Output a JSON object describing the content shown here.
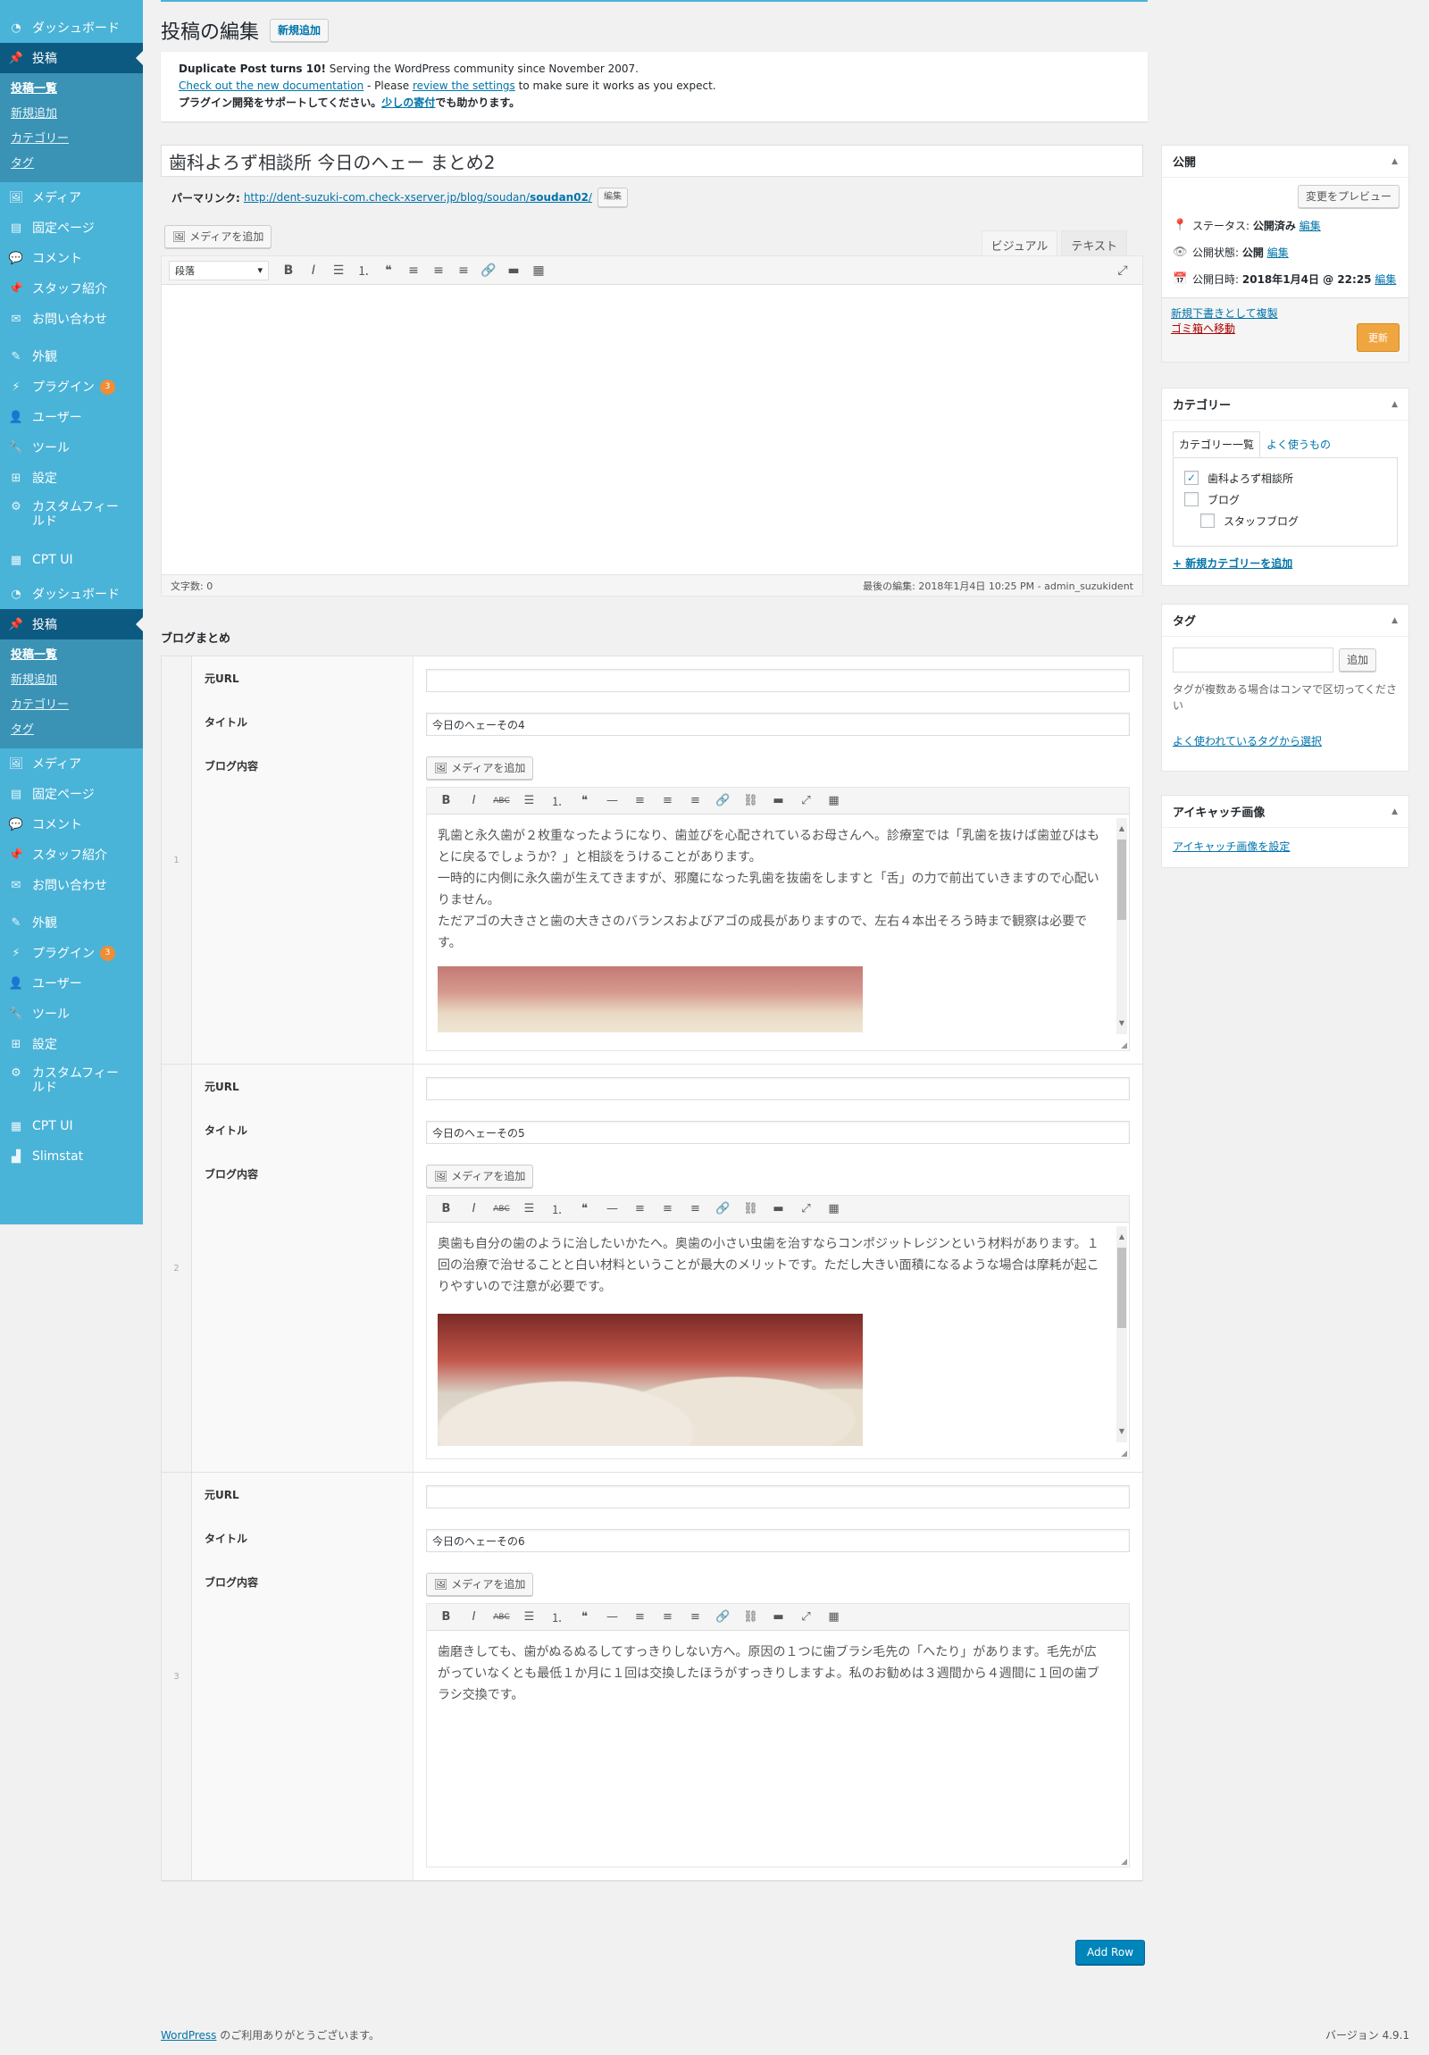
{
  "sidebar": {
    "menu1": [
      {
        "label": "ダッシュボード",
        "icon": "dashboard-icon"
      },
      {
        "label": "投稿",
        "icon": "pin-icon"
      },
      {
        "label": "メディア",
        "icon": "media-icon"
      },
      {
        "label": "固定ページ",
        "icon": "page-icon"
      },
      {
        "label": "コメント",
        "icon": "comment-icon"
      },
      {
        "label": "スタッフ紹介",
        "icon": "pin-icon"
      },
      {
        "label": "お問い合わせ",
        "icon": "mail-icon"
      },
      {
        "label": "外観",
        "icon": "brush-icon"
      },
      {
        "label": "プラグイン",
        "icon": "plugin-icon",
        "badge": "3"
      },
      {
        "label": "ユーザー",
        "icon": "user-icon"
      },
      {
        "label": "ツール",
        "icon": "wrench-icon"
      },
      {
        "label": "設定",
        "icon": "settings-icon"
      },
      {
        "label": "カスタムフィールド",
        "icon": "gear-icon"
      },
      {
        "label": "CPT UI",
        "icon": "cpt-icon"
      }
    ],
    "menu2": [
      {
        "label": "ダッシュボード",
        "icon": "dashboard-icon"
      },
      {
        "label": "投稿",
        "icon": "pin-icon"
      },
      {
        "label": "メディア",
        "icon": "media-icon"
      },
      {
        "label": "固定ページ",
        "icon": "page-icon"
      },
      {
        "label": "コメント",
        "icon": "comment-icon"
      },
      {
        "label": "スタッフ紹介",
        "icon": "pin-icon"
      },
      {
        "label": "お問い合わせ",
        "icon": "mail-icon"
      },
      {
        "label": "外観",
        "icon": "brush-icon"
      },
      {
        "label": "プラグイン",
        "icon": "plugin-icon",
        "badge": "3"
      },
      {
        "label": "ユーザー",
        "icon": "user-icon"
      },
      {
        "label": "ツール",
        "icon": "wrench-icon"
      },
      {
        "label": "設定",
        "icon": "settings-icon"
      },
      {
        "label": "カスタムフィールド",
        "icon": "gear-icon"
      },
      {
        "label": "CPT UI",
        "icon": "cpt-icon"
      },
      {
        "label": "Slimstat",
        "icon": "chart-icon"
      }
    ],
    "submenu": [
      "投稿一覧",
      "新規追加",
      "カテゴリー",
      "タグ"
    ]
  },
  "header": {
    "title": "投稿の編集",
    "add_new": "新規追加"
  },
  "notice": {
    "line1_bold": "Duplicate Post turns 10!",
    "line1_rest": " Serving the WordPress community since November 2007.",
    "line2_link1": "Check out the new documentation",
    "line2_mid": " - Please ",
    "line2_link2": "review the settings",
    "line2_end": " to make sure it works as you expect.",
    "line3_text": "プラグイン開発をサポートしてください。",
    "line3_link": "少しの寄付",
    "line3_end": "でも助かります。"
  },
  "post": {
    "title": "歯科よろず相談所 今日のヘェー まとめ2",
    "permalink_label": "パーマリンク:",
    "permalink_base": "http://dent-suzuki-com.check-xserver.jp/blog/soudan/",
    "permalink_slug": "soudan02",
    "permalink_end": "/",
    "edit_btn": "編集"
  },
  "editor": {
    "add_media": "メディアを追加",
    "tab_visual": "ビジュアル",
    "tab_text": "テキスト",
    "format": "段落",
    "word_count": "文字数: 0",
    "last_edited": "最後の編集: 2018年1月4日 10:25 PM - admin_suzukident"
  },
  "acf": {
    "section_title": "ブログまとめ",
    "label_url": "元URL",
    "label_title": "タイトル",
    "label_content": "ブログ内容",
    "add_media": "メディアを追加",
    "add_row": "Add Row",
    "rows": [
      {
        "num": "1",
        "url": "",
        "title": "今日のヘェーその4",
        "paragraphs": [
          "乳歯と永久歯が２枚重なったようになり、歯並びを心配されているお母さんへ。診療室では「乳歯を抜けば歯並びはもとに戻るでしょうか？」と相談をうけることがあります。",
          "一時的に内側に永久歯が生えてきますが、邪魔になった乳歯を抜歯をしますと「舌」の力で前出ていきますので心配いりません。",
          "ただアゴの大きさと歯の大きさのバランスおよびアゴの成長がありますので、左右４本出そろう時まで観察は必要です。"
        ]
      },
      {
        "num": "2",
        "url": "",
        "title": "今日のヘェーその5",
        "paragraphs": [
          "奥歯も自分の歯のように治したいかたへ。奥歯の小さい虫歯を治すならコンポジットレジンという材料があります。１回の治療で治せることと白い材料ということが最大のメリットです。ただし大きい面積になるような場合は摩耗が起こりやすいので注意が必要です。"
        ]
      },
      {
        "num": "3",
        "url": "",
        "title": "今日のヘェーその6",
        "paragraphs": [
          "歯磨きしても、歯がぬるぬるしてすっきりしない方へ。原因の１つに歯ブラシ毛先の「へたり」があります。毛先が広がっていなくとも最低１か月に１回は交換したほうがすっきりしますよ。私のお勧めは３週間から４週間に１回の歯ブラシ交換です。"
        ]
      }
    ]
  },
  "publish": {
    "title": "公開",
    "preview": "変更をプレビュー",
    "status_label": "ステータス:",
    "status_value": "公開済み",
    "visibility_label": "公開状態:",
    "visibility_value": "公開",
    "date_label": "公開日時:",
    "date_value": "2018年1月4日 @ 22:25",
    "edit": "編集",
    "copy_draft": "新規下書きとして複製",
    "trash": "ゴミ箱へ移動",
    "update": "更新"
  },
  "categories": {
    "title": "カテゴリー",
    "tab_all": "カテゴリー一覧",
    "tab_popular": "よく使うもの",
    "items": [
      {
        "label": "歯科よろず相談所",
        "checked": true
      },
      {
        "label": "ブログ",
        "checked": false
      },
      {
        "label": "スタッフブログ",
        "checked": false
      }
    ],
    "add_new": "+ 新規カテゴリーを追加"
  },
  "tags": {
    "title": "タグ",
    "add": "追加",
    "help": "タグが複数ある場合はコンマで区切ってください",
    "choose": "よく使われているタグから選択"
  },
  "thumbnail": {
    "title": "アイキャッチ画像",
    "set": "アイキャッチ画像を設定"
  },
  "footer": {
    "wp_link": "WordPress",
    "thanks": " のご利用ありがとうございます。",
    "version": "バージョン 4.9.1"
  }
}
